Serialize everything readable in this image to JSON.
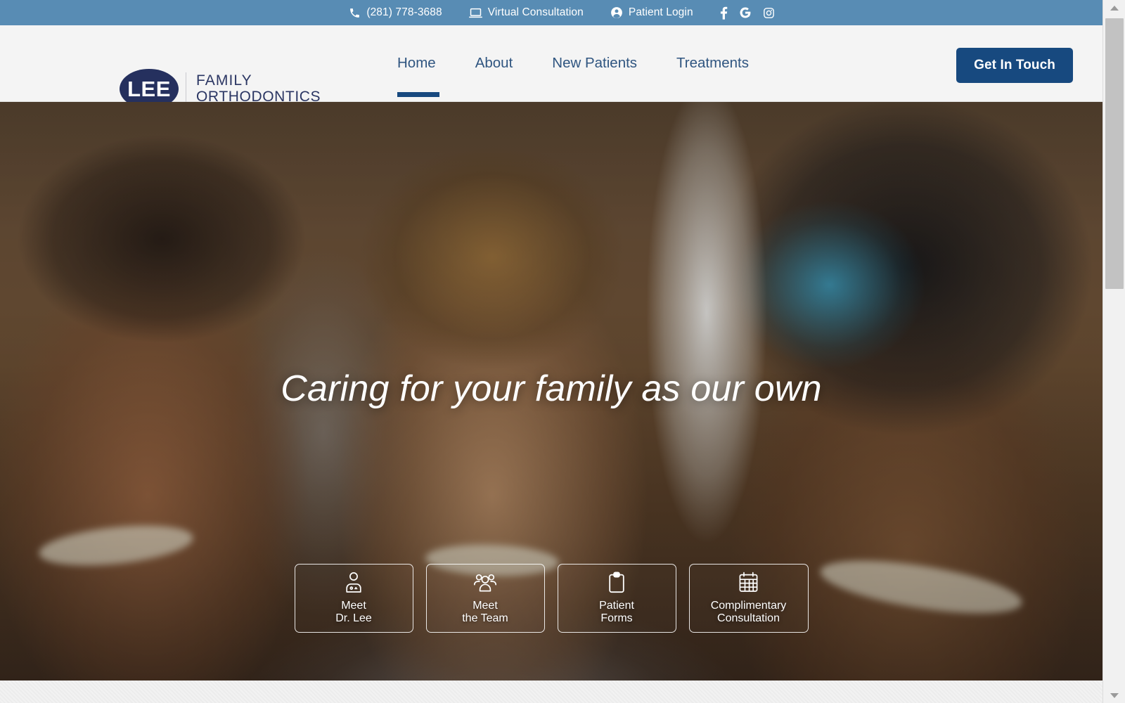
{
  "topbar": {
    "background": "#588cb4",
    "phone": {
      "icon": "phone-icon",
      "label": "(281) 778-3688"
    },
    "virtual": {
      "icon": "laptop-icon",
      "label": "Virtual Consultation"
    },
    "login": {
      "icon": "user-circle-icon",
      "label": "Patient Login"
    },
    "socials": [
      {
        "icon": "facebook-icon",
        "label": "f"
      },
      {
        "icon": "google-icon",
        "label": "G"
      },
      {
        "icon": "instagram-icon",
        "label": ""
      }
    ]
  },
  "header": {
    "background": "#f4f4f4",
    "logo": {
      "badge_text": "LEE",
      "line1": "FAMILY",
      "line2": "ORTHODONTICS",
      "badge_color": "#25305e",
      "text_color": "#2b3663"
    },
    "nav": [
      {
        "label": "Home",
        "active": true
      },
      {
        "label": "About",
        "active": false
      },
      {
        "label": "New Patients",
        "active": false
      },
      {
        "label": "Treatments",
        "active": false
      }
    ],
    "nav_color": "#2f5580",
    "active_underline_color": "#17497f",
    "cta": {
      "label": "Get In Touch",
      "color": "#17497f"
    }
  },
  "hero": {
    "headline": "Caring for your family as our own",
    "cards": [
      {
        "icon": "doctor-icon",
        "label": "Meet\nDr. Lee"
      },
      {
        "icon": "team-icon",
        "label": "Meet\nthe Team"
      },
      {
        "icon": "clipboard-icon",
        "label": "Patient\nForms"
      },
      {
        "icon": "calendar-icon",
        "label": "Complimentary\nConsultation"
      }
    ]
  },
  "scrollbar": {
    "up_arrow": "scroll-up-arrow",
    "down_arrow": "scroll-down-arrow"
  }
}
